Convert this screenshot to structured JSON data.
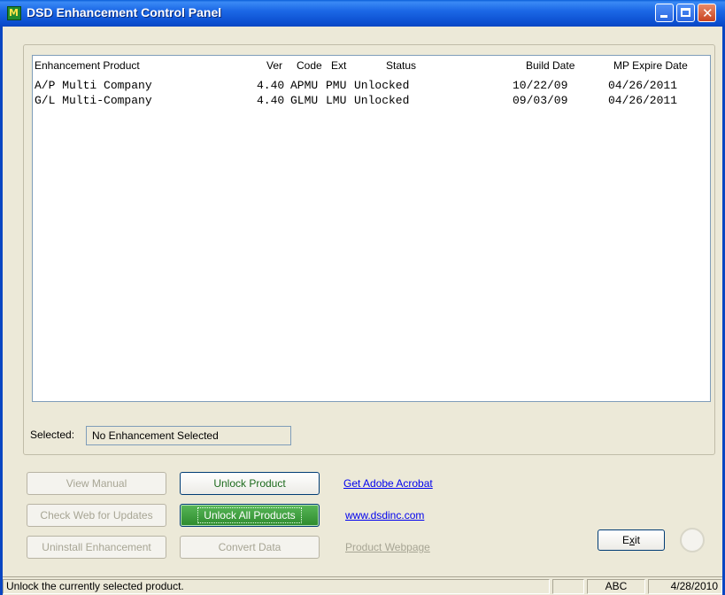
{
  "window": {
    "title": "DSD Enhancement Control Panel",
    "app_icon_text": "M"
  },
  "list": {
    "headers": {
      "product": "Enhancement Product",
      "ver": "Ver",
      "code": "Code",
      "ext": "Ext",
      "status": "Status",
      "build_date": "Build Date",
      "expire_date": "MP Expire Date"
    },
    "rows": [
      {
        "product": "A/P Multi Company",
        "ver": "4.40",
        "code": "APMU",
        "ext": "PMU",
        "status": "Unlocked",
        "build_date": "10/22/09",
        "expire_date": "04/26/2011"
      },
      {
        "product": "G/L Multi-Company",
        "ver": "4.40",
        "code": "GLMU",
        "ext": "LMU",
        "status": "Unlocked",
        "build_date": "09/03/09",
        "expire_date": "04/26/2011"
      }
    ]
  },
  "selected": {
    "label": "Selected:",
    "value": "No Enhancement Selected"
  },
  "buttons": {
    "view_manual": "View Manual",
    "check_web": "Check Web for Updates",
    "uninstall": "Uninstall Enhancement",
    "unlock_product": "Unlock Product",
    "unlock_all": "Unlock All Products",
    "convert_data": "Convert Data",
    "exit": "Exit"
  },
  "links": {
    "adobe": "Get Adobe Acrobat",
    "website": "www.dsdinc.com",
    "product_webpage": "Product Webpage"
  },
  "statusbar": {
    "message": "Unlock the currently selected product.",
    "empty": "",
    "mode": "ABC",
    "date": "4/28/2010"
  },
  "colors": {
    "titlebar": "#0b4fd0",
    "enabled_text": "#1c6a1c",
    "primary": "#2d8a2d",
    "link": "#0000ee"
  }
}
